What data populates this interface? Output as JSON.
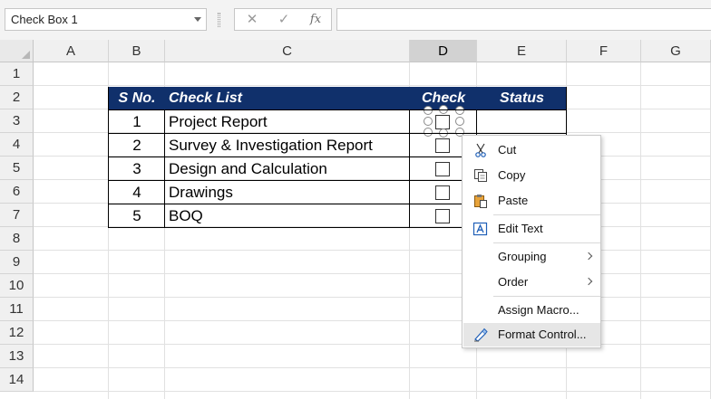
{
  "name_box": {
    "value": "Check Box 1"
  },
  "formula_bar": {
    "cancel_glyph": "✕",
    "enter_glyph": "✓",
    "fx_glyph": "fx",
    "value": ""
  },
  "columns": [
    "A",
    "B",
    "C",
    "D",
    "E",
    "F",
    "G"
  ],
  "selected_column": "D",
  "rows": [
    "1",
    "2",
    "3",
    "4",
    "5",
    "6",
    "7",
    "8",
    "9",
    "10",
    "11",
    "12",
    "13",
    "14"
  ],
  "table": {
    "header": {
      "sno": "S No.",
      "checklist": "Check List",
      "check": "Check",
      "status": "Status"
    },
    "rows": [
      {
        "sno": "1",
        "item": "Project Report"
      },
      {
        "sno": "2",
        "item": "Survey & Investigation Report"
      },
      {
        "sno": "3",
        "item": "Design and Calculation"
      },
      {
        "sno": "4",
        "item": "Drawings"
      },
      {
        "sno": "5",
        "item": "BOQ"
      }
    ]
  },
  "context_menu": {
    "items": [
      {
        "id": "cut",
        "label": "Cut",
        "icon": "scissors-icon"
      },
      {
        "id": "copy",
        "label": "Copy",
        "icon": "copy-icon"
      },
      {
        "id": "paste",
        "label": "Paste",
        "icon": "paste-icon"
      },
      {
        "id": "edit-text",
        "label": "Edit Text",
        "icon": "edit-text-icon"
      },
      {
        "id": "grouping",
        "label": "Grouping",
        "submenu": true
      },
      {
        "id": "order",
        "label": "Order",
        "submenu": true
      },
      {
        "id": "assign-macro",
        "label": "Assign Macro..."
      },
      {
        "id": "format-control",
        "label": "Format Control...",
        "icon": "format-control-icon",
        "highlighted": true
      }
    ]
  },
  "colors": {
    "header_fill": "#10306b",
    "header_text": "#ffffff",
    "menu_highlight": "#e6e6e6"
  }
}
